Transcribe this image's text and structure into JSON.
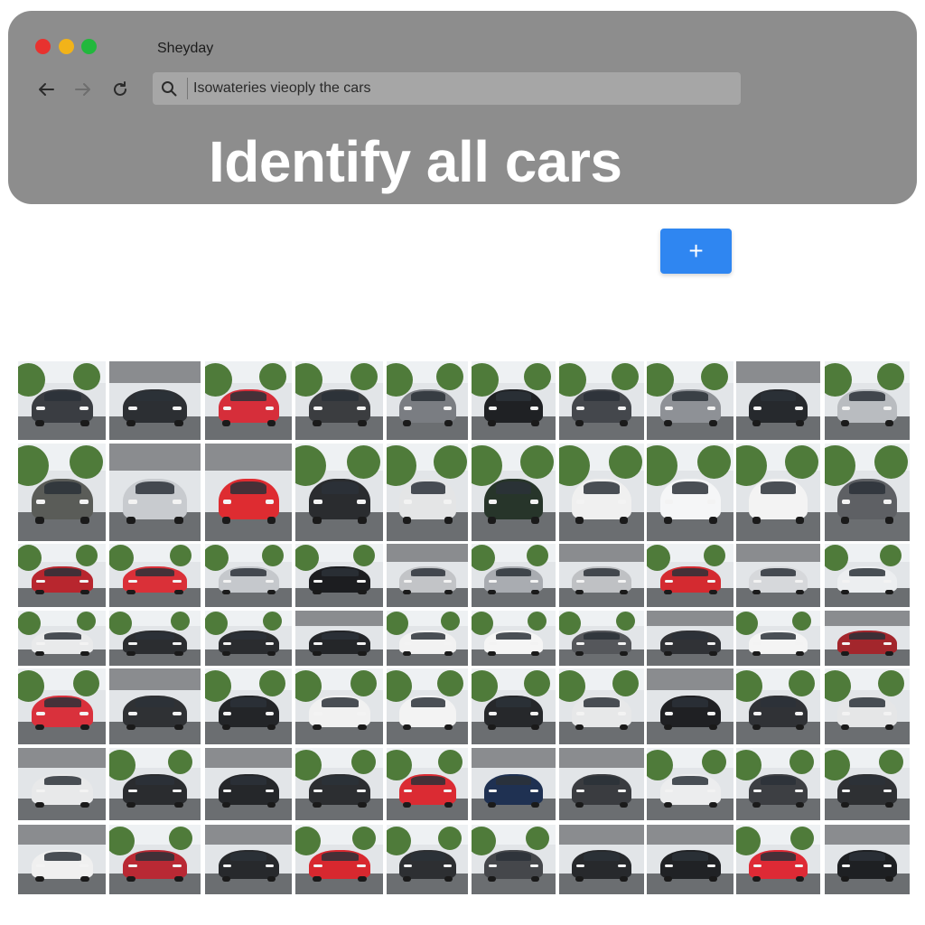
{
  "window": {
    "title": "Sheyday",
    "traffic_lights": [
      "#e8322f",
      "#f2b319",
      "#22b83d"
    ]
  },
  "toolbar": {
    "back_icon": "arrow-left-icon",
    "forward_icon": "arrow-right-icon",
    "reload_icon": "reload-icon",
    "search_icon": "search-icon",
    "address_text": "Isowateries vieoply the cars"
  },
  "task": {
    "headline": "Identify all cars",
    "add_button_label": "+"
  },
  "grid": {
    "rows": 7,
    "columns": 10,
    "tiles": [
      {
        "car_color": "#3a3d42",
        "scene": "trees"
      },
      {
        "car_color": "#2c2f33",
        "scene": "garage"
      },
      {
        "car_color": "#d62e3a",
        "scene": "trees"
      },
      {
        "car_color": "#3b3d40",
        "scene": "trees"
      },
      {
        "car_color": "#7a7d82",
        "scene": "trees"
      },
      {
        "car_color": "#1f2124",
        "scene": "trees"
      },
      {
        "car_color": "#44474c",
        "scene": "trees"
      },
      {
        "car_color": "#8e9196",
        "scene": "trees"
      },
      {
        "car_color": "#26292d",
        "scene": "garage"
      },
      {
        "car_color": "#b9bcc0",
        "scene": "trees"
      },
      {
        "car_color": "#5a5c58",
        "scene": "trees"
      },
      {
        "car_color": "#c8cbcf",
        "scene": "garage"
      },
      {
        "car_color": "#de2c31",
        "scene": "garage"
      },
      {
        "car_color": "#2a2c2f",
        "scene": "trees"
      },
      {
        "car_color": "#e4e5e6",
        "scene": "trees"
      },
      {
        "car_color": "#27352a",
        "scene": "trees"
      },
      {
        "car_color": "#f0f0f0",
        "scene": "trees"
      },
      {
        "car_color": "#f5f6f7",
        "scene": "trees"
      },
      {
        "car_color": "#f3f3f3",
        "scene": "trees"
      },
      {
        "car_color": "#5e6064",
        "scene": "trees"
      },
      {
        "car_color": "#b8262e",
        "scene": "trees"
      },
      {
        "car_color": "#da3038",
        "scene": "trees"
      },
      {
        "car_color": "#c5c8cc",
        "scene": "trees"
      },
      {
        "car_color": "#1c1d20",
        "scene": "trees"
      },
      {
        "car_color": "#c2c4c7",
        "scene": "garage"
      },
      {
        "car_color": "#a9acb1",
        "scene": "trees"
      },
      {
        "car_color": "#bfc1c4",
        "scene": "garage"
      },
      {
        "car_color": "#d42a30",
        "scene": "trees"
      },
      {
        "car_color": "#d6d8db",
        "scene": "garage"
      },
      {
        "car_color": "#eceef0",
        "scene": "trees"
      },
      {
        "car_color": "#e9eaeb",
        "scene": "trees"
      },
      {
        "car_color": "#2b2d30",
        "scene": "trees"
      },
      {
        "car_color": "#2a2c2f",
        "scene": "trees"
      },
      {
        "car_color": "#242629",
        "scene": "garage"
      },
      {
        "car_color": "#f2f2f2",
        "scene": "trees"
      },
      {
        "car_color": "#f5f5f5",
        "scene": "trees"
      },
      {
        "car_color": "#55575b",
        "scene": "trees"
      },
      {
        "car_color": "#303236",
        "scene": "garage"
      },
      {
        "car_color": "#f4f4f4",
        "scene": "trees"
      },
      {
        "car_color": "#a3262c",
        "scene": "garage"
      },
      {
        "car_color": "#d9313c",
        "scene": "trees"
      },
      {
        "car_color": "#2f3134",
        "scene": "garage"
      },
      {
        "car_color": "#232528",
        "scene": "trees"
      },
      {
        "car_color": "#f1f1f1",
        "scene": "trees"
      },
      {
        "car_color": "#f3f3f3",
        "scene": "trees"
      },
      {
        "car_color": "#26282b",
        "scene": "trees"
      },
      {
        "car_color": "#e7e8e9",
        "scene": "trees"
      },
      {
        "car_color": "#1f2023",
        "scene": "garage"
      },
      {
        "car_color": "#303236",
        "scene": "trees"
      },
      {
        "car_color": "#e5e6e7",
        "scene": "trees"
      },
      {
        "car_color": "#e8e9ea",
        "scene": "garage"
      },
      {
        "car_color": "#2a2c2f",
        "scene": "trees"
      },
      {
        "car_color": "#25272a",
        "scene": "garage"
      },
      {
        "car_color": "#2c2e31",
        "scene": "trees"
      },
      {
        "car_color": "#db2b33",
        "scene": "trees"
      },
      {
        "car_color": "#1f3152",
        "scene": "garage"
      },
      {
        "car_color": "#3a3c40",
        "scene": "garage"
      },
      {
        "car_color": "#ecedee",
        "scene": "trees"
      },
      {
        "car_color": "#3d3f43",
        "scene": "trees"
      },
      {
        "car_color": "#2e3033",
        "scene": "trees"
      },
      {
        "car_color": "#f0f0f0",
        "scene": "garage"
      },
      {
        "car_color": "#b92934",
        "scene": "trees"
      },
      {
        "car_color": "#27292c",
        "scene": "garage"
      },
      {
        "car_color": "#d8282f",
        "scene": "trees"
      },
      {
        "car_color": "#2d2f32",
        "scene": "trees"
      },
      {
        "car_color": "#45474b",
        "scene": "trees"
      },
      {
        "car_color": "#27292c",
        "scene": "garage"
      },
      {
        "car_color": "#202225",
        "scene": "garage"
      },
      {
        "car_color": "#de2a35",
        "scene": "trees"
      },
      {
        "car_color": "#1e2023",
        "scene": "garage"
      }
    ]
  }
}
